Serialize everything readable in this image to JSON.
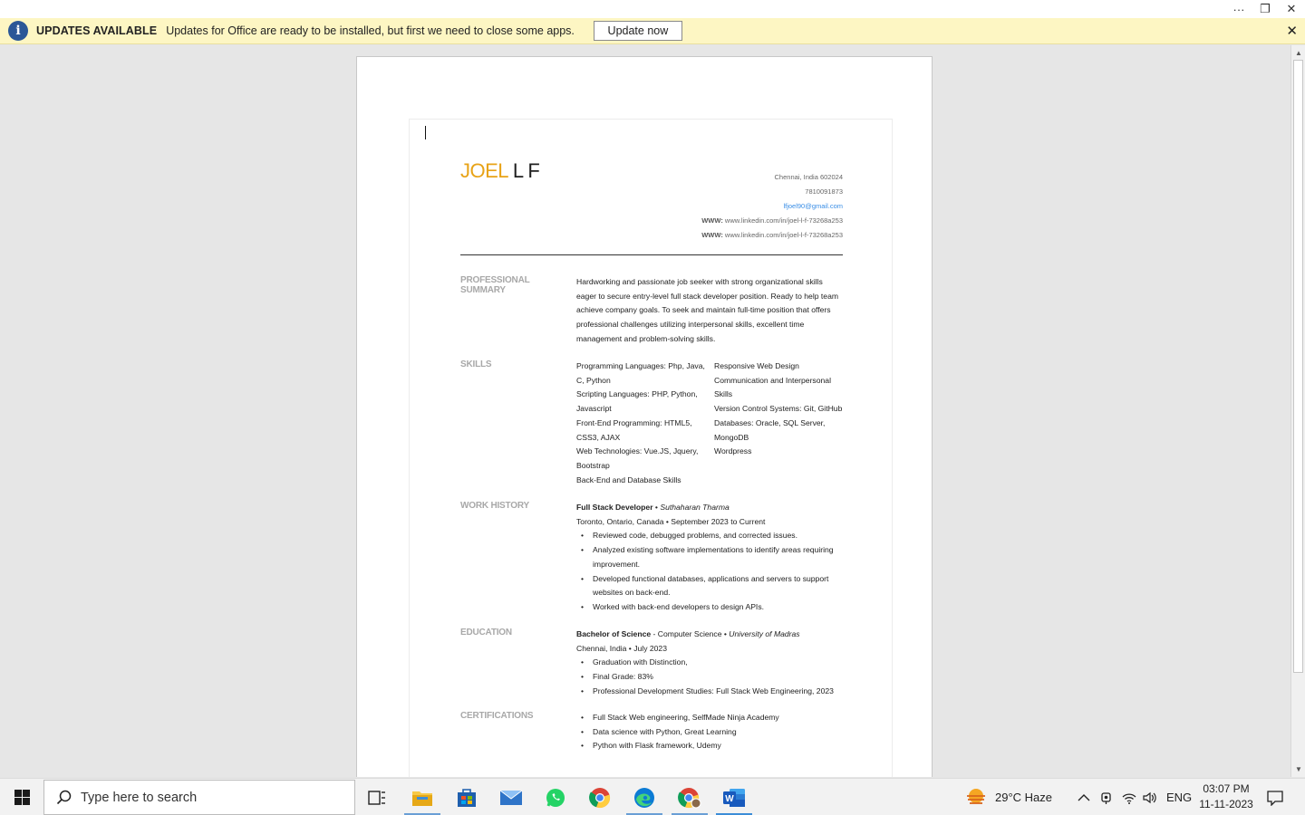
{
  "titlebar": {
    "more": "···",
    "restore": "❐",
    "close": "✕"
  },
  "update_bar": {
    "title": "UPDATES AVAILABLE",
    "message": "Updates for Office are ready to be installed, but first we need to close some apps.",
    "button": "Update now",
    "close": "✕"
  },
  "resume": {
    "first_name": "JOEL",
    "last_name": "L F",
    "contact": {
      "location": "Chennai, India 602024",
      "phone": "7810091873",
      "email": "lfjoel90@gmail.com",
      "www_label": "WWW:",
      "www1": "www.linkedin.com/in/joel-l-f-73268a253",
      "www2": "www.linkedin.com/in/joel-l-f-73268a253"
    },
    "summary": {
      "label": "PROFESSIONAL SUMMARY",
      "text": "Hardworking and passionate job seeker with strong organizational skills eager to secure entry-level full stack developer position. Ready to help team achieve company goals. To seek and maintain full-time position that offers professional challenges utilizing interpersonal skills, excellent time management and problem-solving skills."
    },
    "skills": {
      "label": "SKILLS",
      "left": [
        "Programming Languages: Php, Java, C, Python",
        "Scripting Languages: PHP, Python, Javascript",
        "Front-End Programming: HTML5, CSS3, AJAX",
        "Web Technologies: Vue.JS, Jquery, Bootstrap",
        "Back-End and Database Skills"
      ],
      "right": [
        "Responsive Web Design",
        "Communication and Interpersonal Skills",
        "Version Control Systems: Git, GitHub",
        "Databases: Oracle, SQL Server, MongoDB",
        "Wordpress"
      ]
    },
    "work": {
      "label": "WORK HISTORY",
      "title": "Full Stack Developer",
      "sep": " • ",
      "company": "Suthaharan Tharma",
      "location_dates": "Toronto, Ontario, Canada  •  September 2023 to Current",
      "bullets": [
        "Reviewed code, debugged problems, and corrected issues.",
        "Analyzed existing software implementations to identify areas requiring improvement.",
        "Developed functional databases, applications and servers to support websites on back-end.",
        "Worked with back-end developers to design APIs."
      ]
    },
    "education": {
      "label": "EDUCATION",
      "degree": "Bachelor of Science",
      "field": " - Computer Science  •  ",
      "school": "University of Madras",
      "location_date": "Chennai, India  •  July 2023",
      "bullets": [
        "Graduation with Distinction,",
        "Final Grade: 83%",
        "Professional Development Studies: Full Stack Web Engineering, 2023"
      ]
    },
    "certifications": {
      "label": "CERTIFICATIONS",
      "bullets": [
        "Full Stack Web engineering, SelfMade Ninja Academy",
        "Data science with Python, Great Learning",
        "Python with Flask framework, Udemy"
      ]
    }
  },
  "taskbar": {
    "search_placeholder": "Type here to search",
    "weather": "29°C  Haze",
    "language": "ENG",
    "time": "03:07 PM",
    "date": "11-11-2023"
  },
  "colors": {
    "name_accent": "#e8a317",
    "update_bar_bg": "#fdf6c3",
    "info_icon": "#2b5797"
  }
}
